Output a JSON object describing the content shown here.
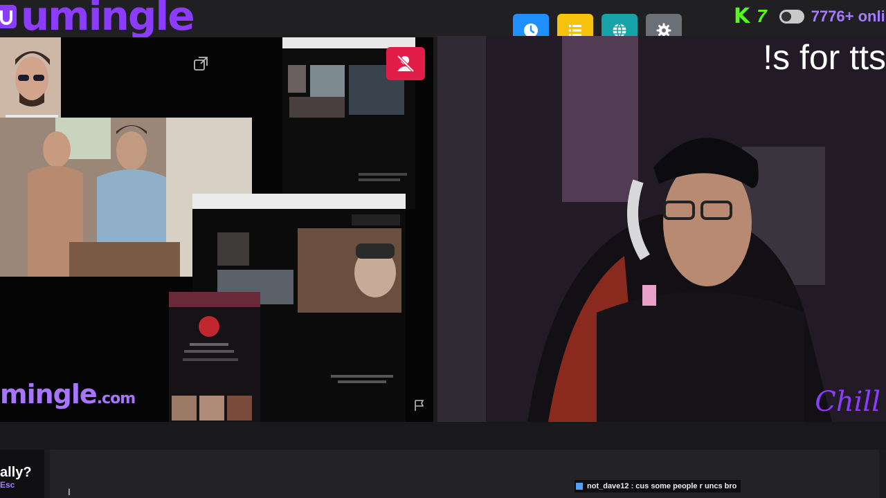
{
  "app": {
    "logo_text": "umingle",
    "brand_color": "#8b3cff"
  },
  "toolbar": {
    "buttons": [
      {
        "name": "history",
        "icon": "clock-icon",
        "color": "#1e90ff"
      },
      {
        "name": "list",
        "icon": "list-icon",
        "color": "#f5c30d"
      },
      {
        "name": "language",
        "icon": "globe-icon",
        "color": "#15a3a8"
      },
      {
        "name": "settings",
        "icon": "gear-icon",
        "color": "#6b6f76"
      }
    ]
  },
  "kick": {
    "logo": "K",
    "viewer_count": "7",
    "online_text": "7776+ onli"
  },
  "stream": {
    "overlay_text": "!s for tts",
    "watermark": "Chill"
  },
  "left": {
    "site_name": "mingle",
    "site_tld": ".com"
  },
  "tip": {
    "question": "ally?",
    "key": "Esc"
  },
  "chat": {
    "message": "not_dave12 : cus some people r uncs bro"
  }
}
